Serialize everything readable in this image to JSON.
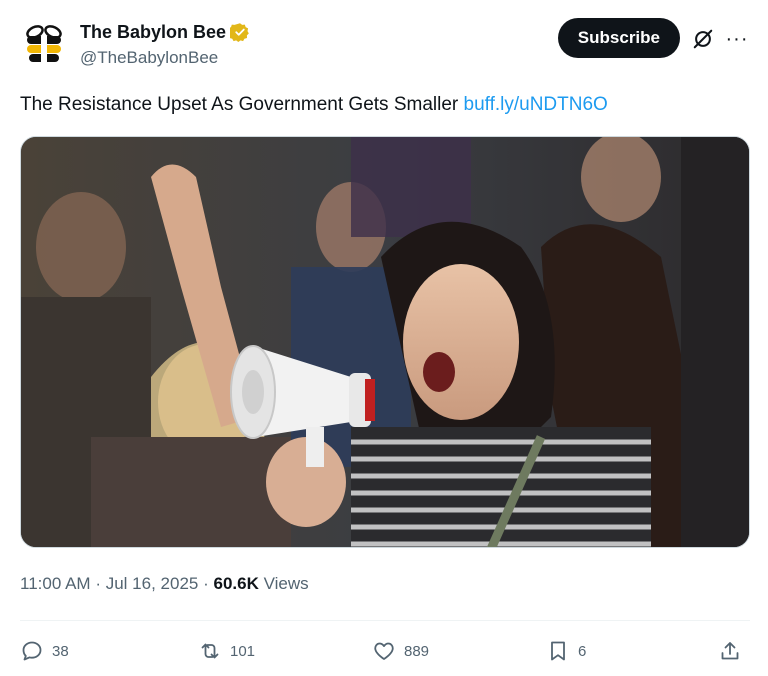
{
  "author": {
    "display_name": "The Babylon Bee",
    "handle": "@TheBabylonBee",
    "avatar_icon": "bee-logo-icon",
    "verified_icon": "verified-gold-badge-icon"
  },
  "header": {
    "subscribe_label": "Subscribe",
    "grok_icon": "grok-icon",
    "more_icon": "more-options-icon",
    "more_glyph": "···"
  },
  "tweet": {
    "text": "The Resistance Upset As Government Gets Smaller",
    "link": "buff.ly/uNDTN6O",
    "media": "protest-photo-woman-shouting-into-megaphone"
  },
  "meta": {
    "time": "11:00 AM",
    "separator": "·",
    "date": "Jul 16, 2025",
    "views_count": "60.6K",
    "views_label": "Views"
  },
  "actions": {
    "replies": "38",
    "reposts": "101",
    "likes": "889",
    "bookmarks": "6"
  },
  "colors": {
    "text": "#0f1419",
    "secondary": "#536471",
    "link": "#1d9bf0",
    "verified": "#e2b719",
    "subscribe_bg": "#0f1419"
  }
}
